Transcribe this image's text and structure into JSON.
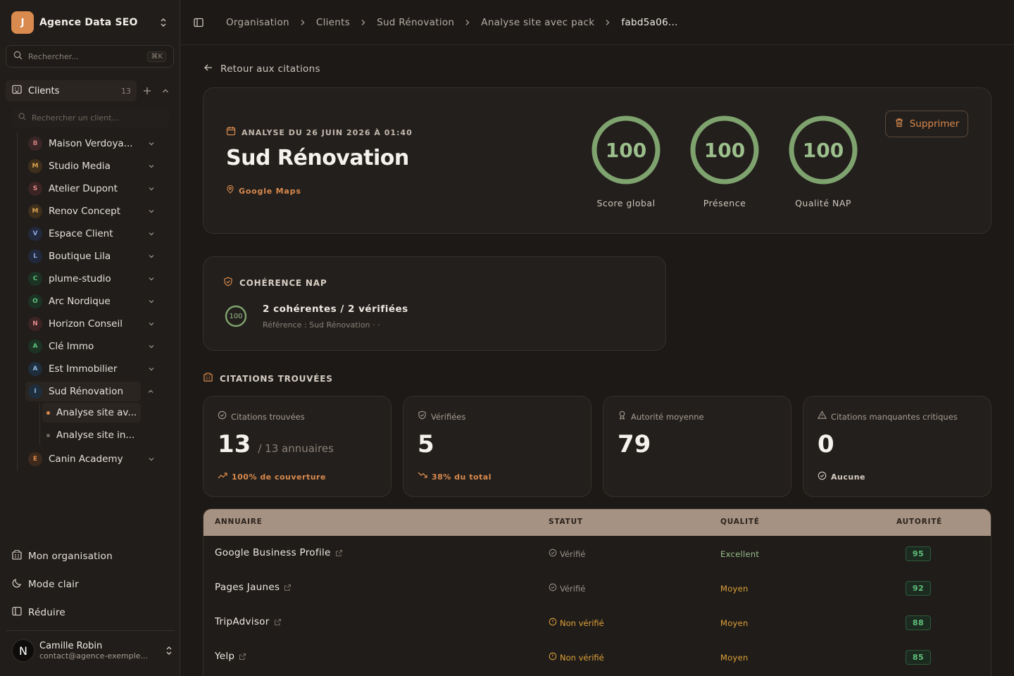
{
  "org": {
    "initial": "J",
    "name": "Agence Data SEO",
    "logo_color": "#d98a4e"
  },
  "search": {
    "placeholder": "Rechercher...",
    "shortcut": "⌘K"
  },
  "clients": {
    "label": "Clients",
    "count": "13",
    "search_placeholder": "Rechercher un client...",
    "items": [
      {
        "initial": "B",
        "name": "Maison Verdoya...",
        "color": "#c97a7a",
        "bg": "#3a2626"
      },
      {
        "initial": "M",
        "name": "Studio Media",
        "color": "#d9a24e",
        "bg": "#3d2f1c"
      },
      {
        "initial": "S",
        "name": "Atelier Dupont",
        "color": "#e08a8a",
        "bg": "#3d2424"
      },
      {
        "initial": "M",
        "name": "Renov Concept",
        "color": "#d9a24e",
        "bg": "#3d2f1c"
      },
      {
        "initial": "V",
        "name": "Espace Client",
        "color": "#8aa6e0",
        "bg": "#22293d"
      },
      {
        "initial": "L",
        "name": "Boutique Lila",
        "color": "#8aa6e0",
        "bg": "#22293d"
      },
      {
        "initial": "C",
        "name": "plume-studio",
        "color": "#5fbf7a",
        "bg": "#1c3324"
      },
      {
        "initial": "O",
        "name": "Arc Nordique",
        "color": "#5fbf7a",
        "bg": "#1c3324"
      },
      {
        "initial": "N",
        "name": "Horizon Conseil",
        "color": "#e08a8a",
        "bg": "#3d2424"
      },
      {
        "initial": "A",
        "name": "Clé Immo",
        "color": "#5fbf7a",
        "bg": "#1c3324"
      },
      {
        "initial": "A",
        "name": "Est Immobilier",
        "color": "#8ab6e0",
        "bg": "#1f2e3d"
      },
      {
        "initial": "I",
        "name": "Sud Rénovation",
        "color": "#8ab6e0",
        "bg": "#1f2e3d"
      },
      {
        "initial": "E",
        "name": "Canin Academy",
        "color": "#d98a4e",
        "bg": "#3d2a1c"
      }
    ],
    "sub_items": [
      {
        "name": "Analyse site av...",
        "dot": "#d98a4e"
      },
      {
        "name": "Analyse site in...",
        "dot": "#6f675f"
      }
    ]
  },
  "footer_nav": {
    "organisation": "Mon organisation",
    "theme": "Mode clair",
    "collapse": "Réduire"
  },
  "user": {
    "initial": "N",
    "name": "Camille Robin",
    "email": "contact@agence-exemple..."
  },
  "breadcrumb": [
    "Organisation",
    "Clients",
    "Sud Rénovation",
    "Analyse site avec pack",
    "fabd5a06..."
  ],
  "back_label": "Retour aux citations",
  "hero": {
    "date_label": "ANALYSE DU 26 JUIN 2026 À 01:40",
    "title": "Sud Rénovation",
    "source": "Google Maps",
    "delete_label": "Supprimer",
    "gauges": [
      {
        "value": 100,
        "label": "Score global"
      },
      {
        "value": 100,
        "label": "Présence"
      },
      {
        "value": 100,
        "label": "Qualité NAP"
      }
    ]
  },
  "nap": {
    "heading": "COHÉRENCE NAP",
    "score": "100",
    "summary": "2 cohérentes / 2 vérifiées",
    "reference": "Référence : Sud Rénovation · ·"
  },
  "citations_heading": "CITATIONS TROUVÉES",
  "stats": [
    {
      "label": "Citations trouvées",
      "value": "13",
      "suffix": "/ 13 annuaires",
      "foot": "100% de couverture",
      "foot_color": "#d98a4e"
    },
    {
      "label": "Vérifiées",
      "value": "5",
      "suffix": "",
      "foot": "38% du total",
      "foot_color": "#d98a4e"
    },
    {
      "label": "Autorité moyenne",
      "value": "79",
      "suffix": "",
      "foot": "",
      "foot_color": "#d98a4e"
    },
    {
      "label": "Citations manquantes critiques",
      "value": "0",
      "suffix": "",
      "foot": "Aucune",
      "foot_color": "#d6cdc3"
    }
  ],
  "table": {
    "headers": [
      "ANNUAIRE",
      "STATUT",
      "QUALITÉ",
      "AUTORITÉ"
    ],
    "rows": [
      {
        "name": "Google Business Profile",
        "status": "Vérifié",
        "verified": true,
        "quality": "Excellent",
        "authority": "95"
      },
      {
        "name": "Pages Jaunes",
        "status": "Vérifié",
        "verified": true,
        "quality": "Moyen",
        "authority": "92"
      },
      {
        "name": "TripAdvisor",
        "status": "Non vérifié",
        "verified": false,
        "quality": "Moyen",
        "authority": "88"
      },
      {
        "name": "Yelp",
        "status": "Non vérifié",
        "verified": false,
        "quality": "Moyen",
        "authority": "85"
      }
    ]
  },
  "colors": {
    "accent": "#d98a4e",
    "gauge": "#7fa36e",
    "success": "#5fbf7a",
    "verified": "#9a918a",
    "warning": "#e0a23a"
  }
}
